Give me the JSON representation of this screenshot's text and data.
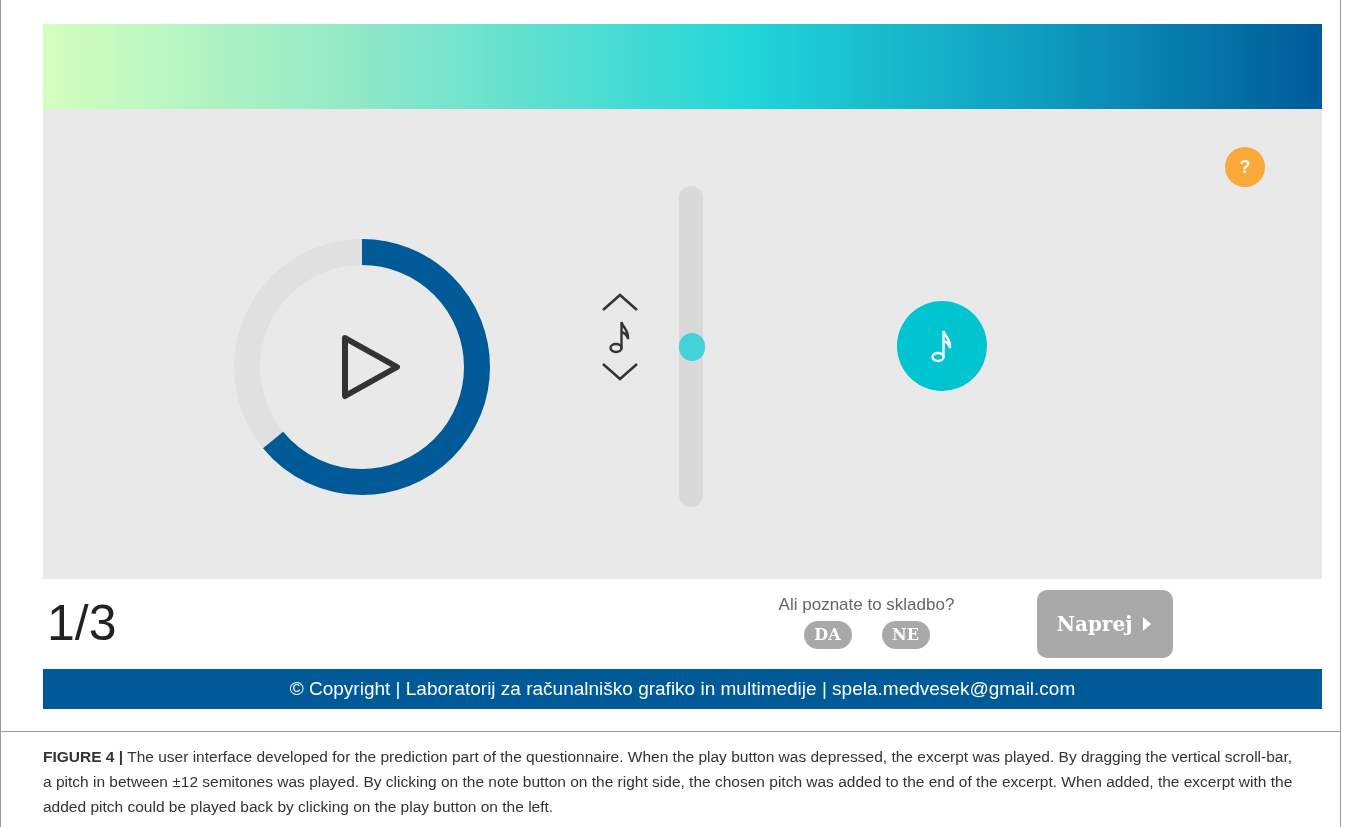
{
  "help_button": "?",
  "pitch_slider": {
    "level": 0.5
  },
  "counter": "1/3",
  "question": {
    "text": "Ali poznate to skladbo?",
    "answers": [
      {
        "label": "DA",
        "selected": false
      },
      {
        "label": "NE",
        "selected": false
      }
    ]
  },
  "next_button": {
    "label": "Naprej",
    "disabled": true
  },
  "footer": "© Copyright | Laboratorij za računalniško grafiko in multimedije | spela.medvesek@gmail.com",
  "caption": "**FIGURE 4 |** The user interface developed for the prediction part of the questionnaire. When the play button was depressed, the excerpt was played. By dragging the vertical scroll-bar, a pitch in between ±12 semitones was played. By clicking on the note button on the right side, the chosen pitch was added to the end of the excerpt. When added, the excerpt with the added pitch could be played back by clicking on the play button on the left."
}
